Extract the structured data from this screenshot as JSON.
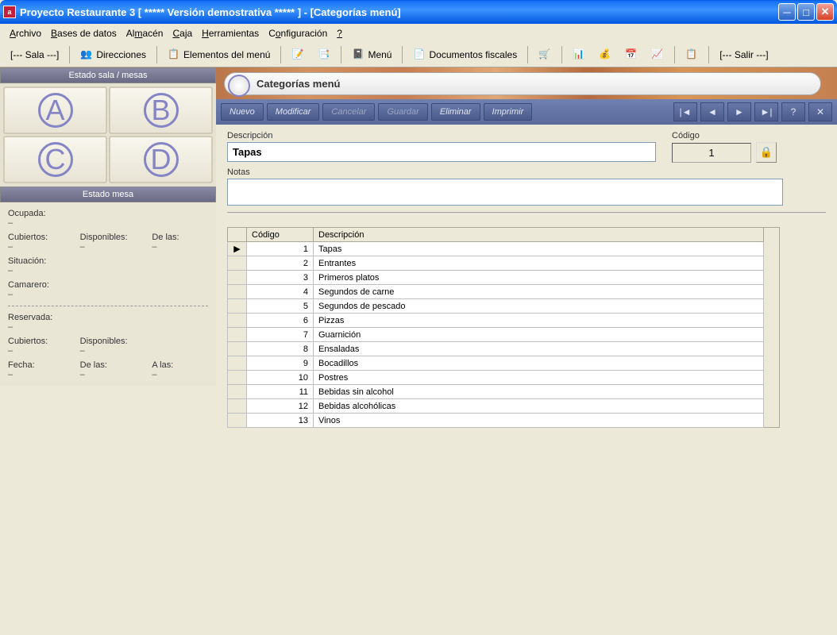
{
  "window": {
    "title": "Proyecto Restaurante 3 [ ***** Versión demostrativa ***** ] - [Categorías menú]"
  },
  "menubar": {
    "archivo": "Archivo",
    "bases": "Bases de datos",
    "almacen": "Almacén",
    "caja": "Caja",
    "herramientas": "Herramientas",
    "config": "Configuración",
    "help": "?"
  },
  "toolbar": {
    "sala": "[--- Sala ---]",
    "direcciones": "Direcciones",
    "elementos": "Elementos del menú",
    "menu": "Menú",
    "docs": "Documentos fiscales",
    "salir": "[--- Salir ---]"
  },
  "left": {
    "salaHeader": "Estado sala / mesas",
    "tables": [
      "A",
      "B",
      "C",
      "D"
    ],
    "mesaHeader": "Estado mesa",
    "ocupada": "Ocupada:",
    "cubiertos": "Cubiertos:",
    "disponibles": "Disponibles:",
    "delas": "De las:",
    "situacion": "Situación:",
    "camarero": "Camarero:",
    "reservada": "Reservada:",
    "fecha": "Fecha:",
    "alas": "A las:",
    "dash": "–"
  },
  "page": {
    "title": "Categorías menú"
  },
  "actions": {
    "nuevo": "Nuevo",
    "modificar": "Modificar",
    "cancelar": "Cancelar",
    "guardar": "Guardar",
    "eliminar": "Eliminar",
    "imprimir": "Imprimir"
  },
  "form": {
    "descLabel": "Descripción",
    "descValue": "Tapas",
    "codLabel": "Código",
    "codValue": "1",
    "notasLabel": "Notas",
    "notasValue": ""
  },
  "table": {
    "headers": {
      "codigo": "Código",
      "desc": "Descripción"
    },
    "rows": [
      {
        "codigo": "1",
        "desc": "Tapas"
      },
      {
        "codigo": "2",
        "desc": "Entrantes"
      },
      {
        "codigo": "3",
        "desc": "Primeros platos"
      },
      {
        "codigo": "4",
        "desc": "Segundos de carne"
      },
      {
        "codigo": "5",
        "desc": "Segundos de pescado"
      },
      {
        "codigo": "6",
        "desc": "Pizzas"
      },
      {
        "codigo": "7",
        "desc": "Guarnición"
      },
      {
        "codigo": "8",
        "desc": "Ensaladas"
      },
      {
        "codigo": "9",
        "desc": "Bocadillos"
      },
      {
        "codigo": "10",
        "desc": "Postres"
      },
      {
        "codigo": "11",
        "desc": "Bebidas sin alcohol"
      },
      {
        "codigo": "12",
        "desc": "Bebidas alcohólicas"
      },
      {
        "codigo": "13",
        "desc": "Vinos"
      }
    ]
  }
}
